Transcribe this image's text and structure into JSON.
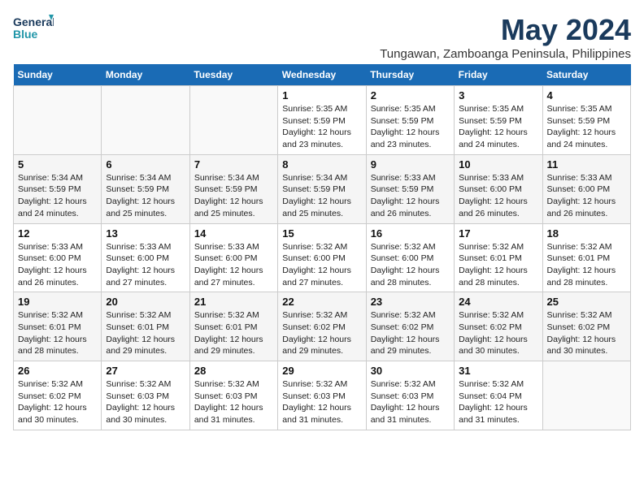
{
  "header": {
    "logo_line1": "General",
    "logo_line2": "Blue",
    "month_year": "May 2024",
    "location": "Tungawan, Zamboanga Peninsula, Philippines"
  },
  "days_of_week": [
    "Sunday",
    "Monday",
    "Tuesday",
    "Wednesday",
    "Thursday",
    "Friday",
    "Saturday"
  ],
  "weeks": [
    [
      {
        "num": "",
        "info": ""
      },
      {
        "num": "",
        "info": ""
      },
      {
        "num": "",
        "info": ""
      },
      {
        "num": "1",
        "info": "Sunrise: 5:35 AM\nSunset: 5:59 PM\nDaylight: 12 hours\nand 23 minutes."
      },
      {
        "num": "2",
        "info": "Sunrise: 5:35 AM\nSunset: 5:59 PM\nDaylight: 12 hours\nand 23 minutes."
      },
      {
        "num": "3",
        "info": "Sunrise: 5:35 AM\nSunset: 5:59 PM\nDaylight: 12 hours\nand 24 minutes."
      },
      {
        "num": "4",
        "info": "Sunrise: 5:35 AM\nSunset: 5:59 PM\nDaylight: 12 hours\nand 24 minutes."
      }
    ],
    [
      {
        "num": "5",
        "info": "Sunrise: 5:34 AM\nSunset: 5:59 PM\nDaylight: 12 hours\nand 24 minutes."
      },
      {
        "num": "6",
        "info": "Sunrise: 5:34 AM\nSunset: 5:59 PM\nDaylight: 12 hours\nand 25 minutes."
      },
      {
        "num": "7",
        "info": "Sunrise: 5:34 AM\nSunset: 5:59 PM\nDaylight: 12 hours\nand 25 minutes."
      },
      {
        "num": "8",
        "info": "Sunrise: 5:34 AM\nSunset: 5:59 PM\nDaylight: 12 hours\nand 25 minutes."
      },
      {
        "num": "9",
        "info": "Sunrise: 5:33 AM\nSunset: 5:59 PM\nDaylight: 12 hours\nand 26 minutes."
      },
      {
        "num": "10",
        "info": "Sunrise: 5:33 AM\nSunset: 6:00 PM\nDaylight: 12 hours\nand 26 minutes."
      },
      {
        "num": "11",
        "info": "Sunrise: 5:33 AM\nSunset: 6:00 PM\nDaylight: 12 hours\nand 26 minutes."
      }
    ],
    [
      {
        "num": "12",
        "info": "Sunrise: 5:33 AM\nSunset: 6:00 PM\nDaylight: 12 hours\nand 26 minutes."
      },
      {
        "num": "13",
        "info": "Sunrise: 5:33 AM\nSunset: 6:00 PM\nDaylight: 12 hours\nand 27 minutes."
      },
      {
        "num": "14",
        "info": "Sunrise: 5:33 AM\nSunset: 6:00 PM\nDaylight: 12 hours\nand 27 minutes."
      },
      {
        "num": "15",
        "info": "Sunrise: 5:32 AM\nSunset: 6:00 PM\nDaylight: 12 hours\nand 27 minutes."
      },
      {
        "num": "16",
        "info": "Sunrise: 5:32 AM\nSunset: 6:00 PM\nDaylight: 12 hours\nand 28 minutes."
      },
      {
        "num": "17",
        "info": "Sunrise: 5:32 AM\nSunset: 6:01 PM\nDaylight: 12 hours\nand 28 minutes."
      },
      {
        "num": "18",
        "info": "Sunrise: 5:32 AM\nSunset: 6:01 PM\nDaylight: 12 hours\nand 28 minutes."
      }
    ],
    [
      {
        "num": "19",
        "info": "Sunrise: 5:32 AM\nSunset: 6:01 PM\nDaylight: 12 hours\nand 28 minutes."
      },
      {
        "num": "20",
        "info": "Sunrise: 5:32 AM\nSunset: 6:01 PM\nDaylight: 12 hours\nand 29 minutes."
      },
      {
        "num": "21",
        "info": "Sunrise: 5:32 AM\nSunset: 6:01 PM\nDaylight: 12 hours\nand 29 minutes."
      },
      {
        "num": "22",
        "info": "Sunrise: 5:32 AM\nSunset: 6:02 PM\nDaylight: 12 hours\nand 29 minutes."
      },
      {
        "num": "23",
        "info": "Sunrise: 5:32 AM\nSunset: 6:02 PM\nDaylight: 12 hours\nand 29 minutes."
      },
      {
        "num": "24",
        "info": "Sunrise: 5:32 AM\nSunset: 6:02 PM\nDaylight: 12 hours\nand 30 minutes."
      },
      {
        "num": "25",
        "info": "Sunrise: 5:32 AM\nSunset: 6:02 PM\nDaylight: 12 hours\nand 30 minutes."
      }
    ],
    [
      {
        "num": "26",
        "info": "Sunrise: 5:32 AM\nSunset: 6:02 PM\nDaylight: 12 hours\nand 30 minutes."
      },
      {
        "num": "27",
        "info": "Sunrise: 5:32 AM\nSunset: 6:03 PM\nDaylight: 12 hours\nand 30 minutes."
      },
      {
        "num": "28",
        "info": "Sunrise: 5:32 AM\nSunset: 6:03 PM\nDaylight: 12 hours\nand 31 minutes."
      },
      {
        "num": "29",
        "info": "Sunrise: 5:32 AM\nSunset: 6:03 PM\nDaylight: 12 hours\nand 31 minutes."
      },
      {
        "num": "30",
        "info": "Sunrise: 5:32 AM\nSunset: 6:03 PM\nDaylight: 12 hours\nand 31 minutes."
      },
      {
        "num": "31",
        "info": "Sunrise: 5:32 AM\nSunset: 6:04 PM\nDaylight: 12 hours\nand 31 minutes."
      },
      {
        "num": "",
        "info": ""
      }
    ]
  ]
}
